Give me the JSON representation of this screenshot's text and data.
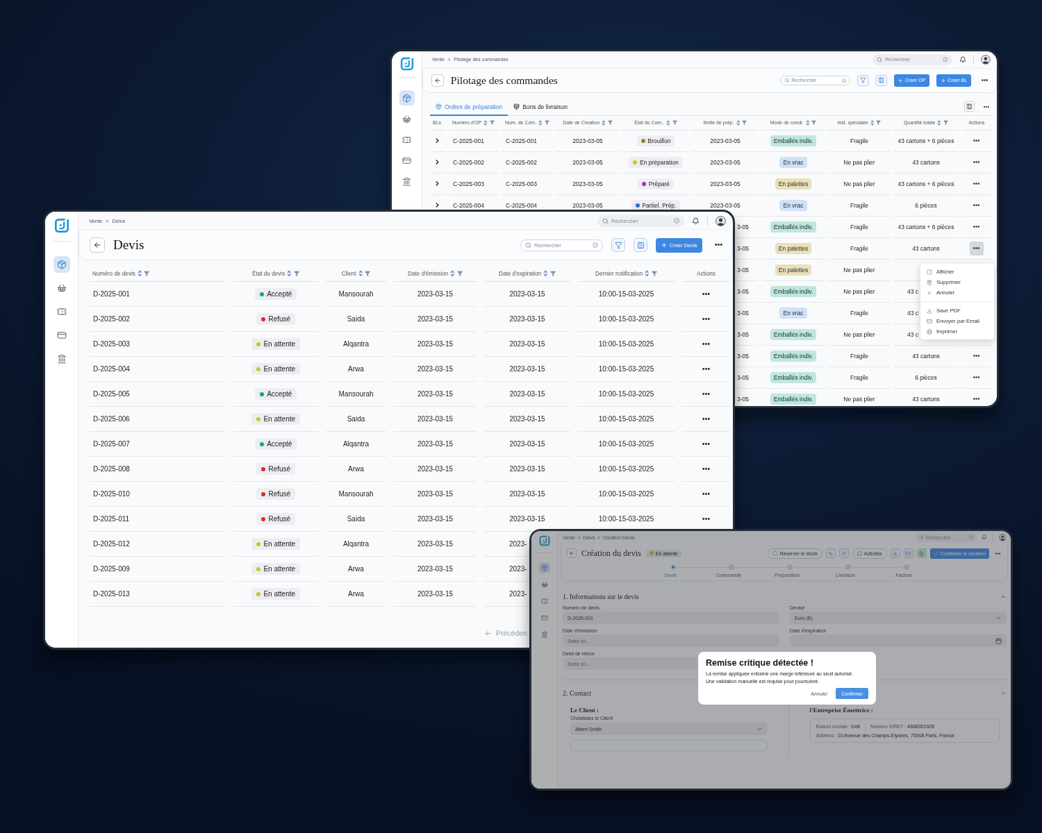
{
  "orders_window": {
    "breadcrumb": [
      "Vente",
      "Pilotage des commandes"
    ],
    "breadcrumb_separator": ">",
    "search_placeholder": "Rechercher",
    "sidebar": [
      {
        "selected": true
      },
      {
        "selected": false
      },
      {
        "selected": false
      },
      {
        "selected": false
      },
      {
        "selected": false
      }
    ],
    "title": "Pilotage des commandes",
    "title_search_placeholder": "Rechercher",
    "buttons": [
      "Creer OP",
      "Creer BL"
    ],
    "tabs": [
      {
        "label": "Ordres de préparation",
        "selected": true
      },
      {
        "label": "Bons de livraison",
        "selected": false
      }
    ],
    "columns": [
      {
        "label": "BLs",
        "sortable": false
      },
      {
        "label": "Numéro d'OP",
        "sortable": true
      },
      {
        "label": "Num. de Com.",
        "sortable": true
      },
      {
        "label": "Date de Creation",
        "sortable": true
      },
      {
        "label": "État du Com..",
        "sortable": true
      },
      {
        "label": "limite de prép.",
        "sortable": true
      },
      {
        "label": "Mode de condi.",
        "sortable": true
      },
      {
        "label": "Inst. spéciales",
        "sortable": true
      },
      {
        "label": "Quantité totale",
        "sortable": true
      },
      {
        "label": "Actions",
        "sortable": false
      }
    ],
    "rows": [
      {
        "expandable": true,
        "op": "C-2025-001",
        "com": "C-2025-001",
        "date": "2023-03-05",
        "state": {
          "label": "Brouillon",
          "color": "#9c8622"
        },
        "limit": "2023-03-05",
        "mode": {
          "label": "Emballés indiv.",
          "color": "#bfe6df"
        },
        "inst": "Fragile",
        "qty": "43 cartons + 6 pièces",
        "actions": true,
        "menu_open": false
      },
      {
        "expandable": true,
        "op": "C-2025-002",
        "com": "C-2025-002",
        "date": "2023-03-05",
        "state": {
          "label": "En préparation",
          "color": "#d6c41c"
        },
        "limit": "2023-03-05",
        "mode": {
          "label": "En vrac",
          "color": "#cfe1f7"
        },
        "inst": "Ne pas plier",
        "qty": "43 cartons",
        "actions": true,
        "menu_open": false
      },
      {
        "expandable": true,
        "op": "C-2025-003",
        "com": "C-2025-003",
        "date": "2023-03-05",
        "state": {
          "label": "Préparé",
          "color": "#9a2fcf"
        },
        "limit": "2023-03-05",
        "mode": {
          "label": "En palettes",
          "color": "#eadfb8"
        },
        "inst": "Ne pas plier",
        "qty": "43 cartons + 6 pièces",
        "actions": true,
        "menu_open": false
      },
      {
        "expandable": true,
        "op": "C-2025-004",
        "com": "C-2025-004",
        "date": "2023-03-05",
        "state": {
          "label": "Partiel. Prép.",
          "color": "#2f6fd1"
        },
        "limit": "2023-03-05",
        "mode": {
          "label": "En vrac",
          "color": "#cfe1f7"
        },
        "inst": "Fragile",
        "qty": "6 pièces",
        "actions": true,
        "menu_open": false
      },
      {
        "expandable": false,
        "limit": {
          "text": "3-05",
          "clipped": true
        },
        "mode": {
          "label": "Emballés indiv.",
          "color": "#bfe6df"
        },
        "inst": "Fragile",
        "qty": "43 cartons + 6 pièces",
        "actions": true,
        "menu_open": false
      },
      {
        "expandable": false,
        "limit": {
          "text": "3-05",
          "clipped": true
        },
        "mode": {
          "label": "En palettes",
          "color": "#eadfb8"
        },
        "inst": "Fragile",
        "qty": "43 cartons",
        "actions": true,
        "menu_open": true
      },
      {
        "expandable": false,
        "limit": {
          "text": "3-05",
          "clipped": true
        },
        "mode": {
          "label": "En palettes",
          "color": "#eadfb8"
        },
        "inst": "Ne pas plier",
        "actions": false
      },
      {
        "expandable": false,
        "limit": {
          "text": "3-05",
          "clipped": true
        },
        "mode": {
          "label": "Emballés indiv.",
          "color": "#bfe6df"
        },
        "inst": "Ne pas plier",
        "qty": {
          "text": "43 c",
          "clipped": true
        },
        "actions": false
      },
      {
        "expandable": false,
        "limit": {
          "text": "3-05",
          "clipped": true
        },
        "mode": {
          "label": "En vrac",
          "color": "#cfe1f7"
        },
        "inst": "Fragile",
        "qty": {
          "text": "43 c",
          "clipped": true
        },
        "actions": false
      },
      {
        "expandable": false,
        "limit": {
          "text": "3-05",
          "clipped": true
        },
        "mode": {
          "label": "Emballés indiv.",
          "color": "#bfe6df"
        },
        "inst": "Ne pas plier",
        "qty": {
          "text": "43 c",
          "clipped": true
        },
        "actions": false
      },
      {
        "expandable": false,
        "limit": {
          "text": "3-05",
          "clipped": true
        },
        "mode": {
          "label": "Emballés indiv.",
          "color": "#bfe6df"
        },
        "inst": "Fragile",
        "qty": "43 cartons",
        "actions": true,
        "menu_open": false
      },
      {
        "expandable": false,
        "limit": {
          "text": "3-05",
          "clipped": true
        },
        "mode": {
          "label": "Emballés indiv.",
          "color": "#bfe6df"
        },
        "inst": "Fragile",
        "qty": "6 pièces",
        "actions": true,
        "menu_open": false
      },
      {
        "expandable": false,
        "limit": {
          "text": "3-05",
          "clipped": true
        },
        "mode": {
          "label": "Emballés indiv.",
          "color": "#bfe6df"
        },
        "inst": "Ne pas plier",
        "qty": "43 cartons",
        "actions": true,
        "menu_open": false
      }
    ],
    "menu": [
      [
        "Afficher",
        "Supprimer",
        "Annuler"
      ],
      [
        "Save PDF",
        "Envoyer par Email",
        "Imprimer"
      ]
    ]
  },
  "quotes_window": {
    "breadcrumb": [
      "Vente",
      "Deivs"
    ],
    "breadcrumb_separator": ">",
    "search_placeholder": "Rechercher",
    "sidebar": [
      {
        "selected": true
      },
      {
        "selected": false
      },
      {
        "selected": false
      },
      {
        "selected": false
      },
      {
        "selected": false
      }
    ],
    "title": "Devis",
    "title_search_placeholder": "Rechercher",
    "create_button": "Creer Devis",
    "columns": [
      {
        "label": "Numéro de devis",
        "sortable": true
      },
      {
        "label": "État du devis",
        "sortable": true
      },
      {
        "label": "Client",
        "sortable": true
      },
      {
        "label": "Date d'émission",
        "sortable": true
      },
      {
        "label": "Date d'expiration",
        "sortable": true
      },
      {
        "label": "Dernier notification",
        "sortable": true
      },
      {
        "label": "Actions",
        "sortable": false
      }
    ],
    "rows": [
      {
        "number": "D-2025-001",
        "state": {
          "label": "Accepté",
          "color": "#17a673"
        },
        "client": "Mansourah",
        "issued": "2023-03-15",
        "expires": "2023-03-15",
        "notified": "10:00-15-03-2025",
        "actions": true
      },
      {
        "number": "D-2025-002",
        "state": {
          "label": "Refusé",
          "color": "#e0262d"
        },
        "client": "Saida",
        "issued": "2023-03-15",
        "expires": "2023-03-15",
        "notified": "10:00-15-03-2025",
        "actions": true
      },
      {
        "number": "D-2025-003",
        "state": {
          "label": "En attente",
          "color": "#cbc61f"
        },
        "client": "Alqantra",
        "issued": "2023-03-15",
        "expires": "2023-03-15",
        "notified": "10:00-15-03-2025",
        "actions": true
      },
      {
        "number": "D-2025-004",
        "state": {
          "label": "En attente",
          "color": "#cbc61f"
        },
        "client": "Arwa",
        "issued": "2023-03-15",
        "expires": "2023-03-15",
        "notified": "10:00-15-03-2025",
        "actions": true
      },
      {
        "number": "D-2025-005",
        "state": {
          "label": "Accepté",
          "color": "#17a673"
        },
        "client": "Mansourah",
        "issued": "2023-03-15",
        "expires": "2023-03-15",
        "notified": "10:00-15-03-2025",
        "actions": true
      },
      {
        "number": "D-2025-006",
        "state": {
          "label": "En attente",
          "color": "#cbc61f"
        },
        "client": "Saida",
        "issued": "2023-03-15",
        "expires": "2023-03-15",
        "notified": "10:00-15-03-2025",
        "actions": true
      },
      {
        "number": "D-2025-007",
        "state": {
          "label": "Accepté",
          "color": "#17a673"
        },
        "client": "Alqantra",
        "issued": "2023-03-15",
        "expires": "2023-03-15",
        "notified": "10:00-15-03-2025",
        "actions": true
      },
      {
        "number": "D-2025-008",
        "state": {
          "label": "Refusé",
          "color": "#e0262d"
        },
        "client": "Arwa",
        "issued": "2023-03-15",
        "expires": "2023-03-15",
        "notified": "10:00-15-03-2025",
        "actions": true
      },
      {
        "number": "D-2025-010",
        "state": {
          "label": "Refusé",
          "color": "#e0262d"
        },
        "client": "Mansourah",
        "issued": "2023-03-15",
        "expires": "2023-03-15",
        "notified": "10:00-15-03-2025",
        "actions": true
      },
      {
        "number": "D-2025-011",
        "state": {
          "label": "Refusé",
          "color": "#e0262d"
        },
        "client": "Saida",
        "issued": "2023-03-15",
        "expires": "2023-03-15",
        "notified": "10:00-15-03-2025",
        "actions": true
      },
      {
        "number": "D-2025-012",
        "state": {
          "label": "En attente",
          "color": "#cbc61f"
        },
        "client": "Alqantra",
        "issued": "2023-03-15",
        "expires": {
          "text": "2023-",
          "clipped": true
        },
        "actions": false
      },
      {
        "number": "D-2025-009",
        "state": {
          "label": "En attente",
          "color": "#cbc61f"
        },
        "client": "Arwa",
        "issued": "2023-03-15",
        "expires": {
          "text": "2023-",
          "clipped": true
        },
        "actions": false
      },
      {
        "number": "D-2025-013",
        "state": {
          "label": "En attente",
          "color": "#cbc61f"
        },
        "client": "Arwa",
        "issued": "2023-03-15",
        "expires": {
          "text": "2023-",
          "clipped": true
        },
        "actions": false
      }
    ],
    "pagination": {
      "previous": "Précéden",
      "disabled": true
    }
  },
  "creation_window": {
    "breadcrumb": [
      "Vente",
      "Deivs",
      "Creation Devis"
    ],
    "breadcrumb_separator": ">",
    "search_placeholder": "Rechercher",
    "sidebar": [
      {
        "selected": true
      },
      {
        "selected": false
      },
      {
        "selected": false
      },
      {
        "selected": false
      },
      {
        "selected": false
      }
    ],
    "title": "Création du devis",
    "status": {
      "label": "En attente"
    },
    "toolbar": {
      "reserve": "Réserver le stock",
      "activities": "Activités",
      "confirm": "Confirmer la création"
    },
    "steps": [
      {
        "label": "Devis",
        "selected": true
      },
      {
        "label": "Commande",
        "selected": false
      },
      {
        "label": "Préparation",
        "selected": false
      },
      {
        "label": "Livraison",
        "selected": false
      },
      {
        "label": "Facture",
        "selected": false
      }
    ],
    "info_section": {
      "title": "1. Informations sur le devis",
      "expanded": true,
      "fields": [
        {
          "kind": "text",
          "label": "Numéro de devis",
          "value": "D-2025-001"
        },
        {
          "kind": "select",
          "label": "Devise",
          "value": "Euro (€)"
        },
        {
          "kind": "text",
          "label": "Date d'émission",
          "placeholder": "Saisir ici..."
        },
        {
          "kind": "date",
          "label": "Date d'expiration"
        },
        {
          "kind": "text",
          "label": "Delai de retour",
          "placeholder": "Saisir ici..."
        }
      ]
    },
    "contact_section": {
      "title": "2. Contact",
      "expanded": true,
      "client": {
        "heading": "Le Client :",
        "label": "Choisissez le Client",
        "value": "Albert Smith"
      },
      "company": {
        "heading": "l'Entreprise Émettrice :",
        "facts": [
          [
            "Raison sociale : **Dell**",
            "Numéro SIRET : **4568301926**"
          ],
          [
            "Address : **10 Avenue des Champs-Élysées, 75008 Paris, France**"
          ]
        ]
      }
    },
    "dialog": {
      "title": "Remise critique détectée !",
      "message": "La remise appliquée entraîne une marge inférieure au seuil autorisé.\nUne validation manuelle est requise pour poursuivre.",
      "cancel": "Annuler",
      "confirm": "Confirmer"
    }
  }
}
